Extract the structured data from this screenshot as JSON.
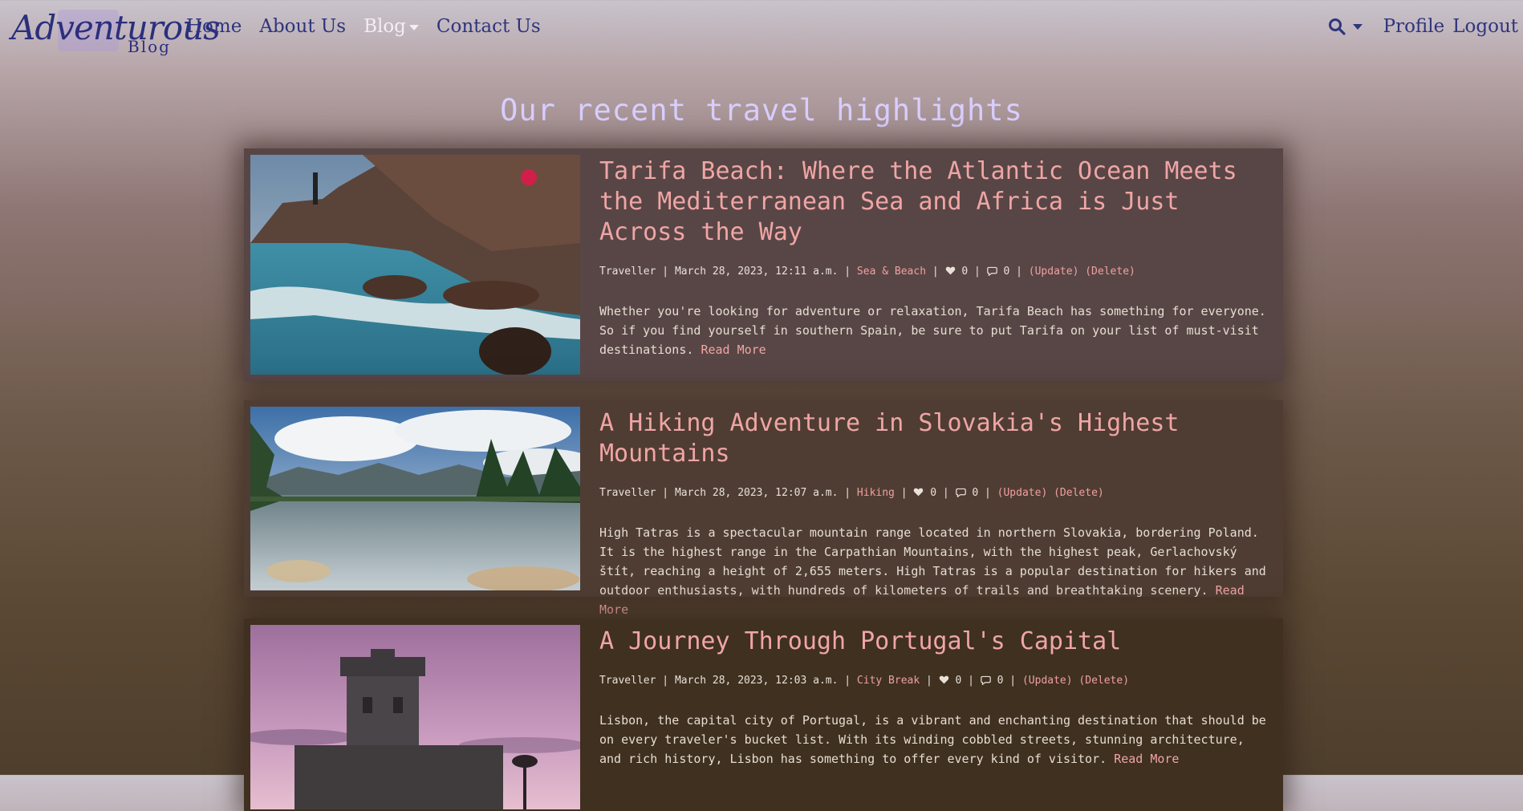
{
  "nav": {
    "logo_script": "Adventurous",
    "logo_sub": "Blog",
    "links": [
      "Home",
      "About Us",
      "Blog",
      "Contact Us"
    ],
    "profile": "Profile",
    "logout": "Logout",
    "search_icon": "search-icon"
  },
  "page_title": "Our recent travel highlights",
  "posts": [
    {
      "title": "Tarifa Beach: Where the Atlantic Ocean Meets the Mediterranean Sea and Africa is Just Across the Way",
      "author": "Traveller",
      "date": "March 28, 2023, 12:11 a.m.",
      "category": "Sea & Beach",
      "likes": "0",
      "comments": "0",
      "update": "(Update)",
      "delete": "(Delete)",
      "excerpt": "Whether you're looking for adventure or relaxation, Tarifa Beach has something for everyone. So if you find yourself in southern Spain, be sure to put Tarifa on your list of must-visit destinations.",
      "read_more": "Read More"
    },
    {
      "title": "A Hiking Adventure in Slovakia's Highest Mountains",
      "author": "Traveller",
      "date": "March 28, 2023, 12:07 a.m.",
      "category": "Hiking",
      "likes": "0",
      "comments": "0",
      "update": "(Update)",
      "delete": "(Delete)",
      "excerpt": "High Tatras is a spectacular mountain range located in northern Slovakia, bordering Poland. It is the highest range in the Carpathian Mountains, with the highest peak, Gerlachovský štít, reaching a height of 2,655 meters. High Tatras is a popular destination for hikers and outdoor enthusiasts, with hundreds of kilometers of trails and breathtaking scenery.",
      "read_more": "Read More"
    },
    {
      "title": "A Journey Through Portugal's Capital",
      "author": "Traveller",
      "date": "March 28, 2023, 12:03 a.m.",
      "category": "City Break",
      "likes": "0",
      "comments": "0",
      "update": "(Update)",
      "delete": "(Delete)",
      "excerpt": "Lisbon, the capital city of Portugal, is a vibrant and enchanting destination that should be on every traveler's bucket list. With its winding cobbled streets, stunning architecture, and rich history, Lisbon has something to offer every kind of visitor.",
      "read_more": "Read More"
    }
  ],
  "colors": {
    "nav_text": "#2e357e",
    "title": "#d9ceff",
    "accent": "#f0a5a5"
  }
}
